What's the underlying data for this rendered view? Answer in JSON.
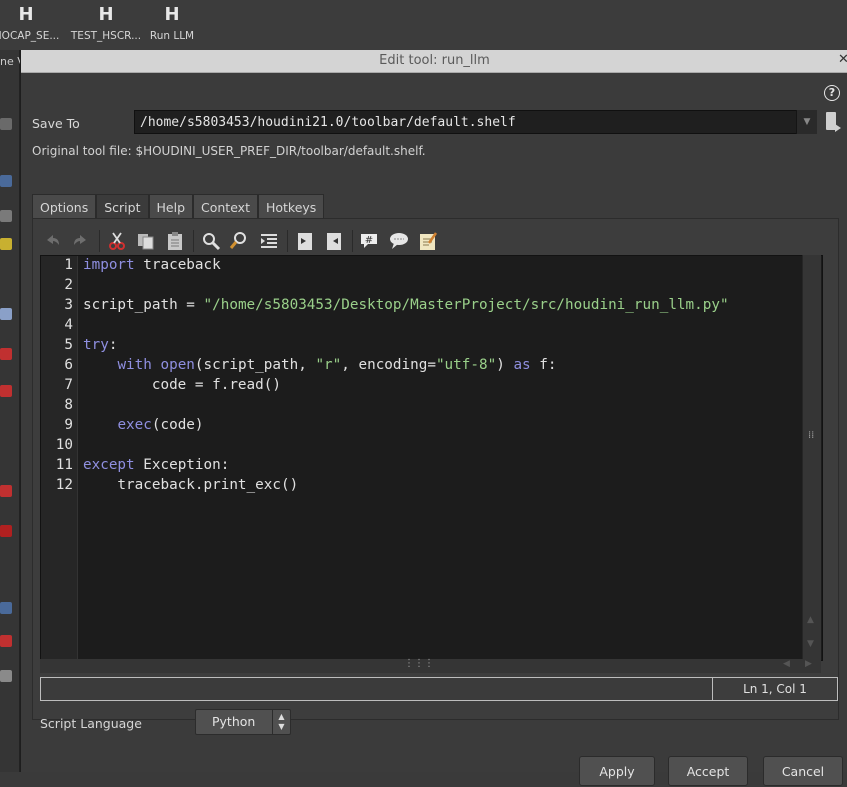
{
  "shelf": {
    "tools": [
      {
        "label": "MOCAP_SE...",
        "icon": "houdini-h-icon"
      },
      {
        "label": "TEST_HSCR...",
        "icon": "houdini-h-icon"
      },
      {
        "label": "Run LLM",
        "icon": "houdini-h-icon"
      }
    ],
    "partial_label": "ne V"
  },
  "dialog": {
    "title": "Edit tool: run_llm",
    "close": "✕",
    "help": "?",
    "save_to_label": "Save To",
    "save_to_value": "/home/s5803453/houdini21.0/toolbar/default.shelf",
    "original_file": "Original tool file: $HOUDINI_USER_PREF_DIR/toolbar/default.shelf.",
    "tabs": [
      "Options",
      "Script",
      "Help",
      "Context",
      "Hotkeys"
    ],
    "active_tab": "Script",
    "toolbar_icons": [
      "undo-icon",
      "redo-icon",
      "cut-icon",
      "copy-icon",
      "paste-icon",
      "find-icon",
      "find-replace-icon",
      "indent-icon",
      "comment-block-icon",
      "uncomment-block-icon",
      "hash-comment-icon",
      "speech-comment-icon",
      "notepad-icon"
    ],
    "code_lines": [
      {
        "n": "1",
        "tokens": [
          [
            "kw",
            "import"
          ],
          [
            "t",
            " traceback"
          ]
        ]
      },
      {
        "n": "2",
        "tokens": []
      },
      {
        "n": "3",
        "tokens": [
          [
            "t",
            "script_path = "
          ],
          [
            "st",
            "\"/home/s5803453/Desktop/MasterProject/src/houdini_run_llm.py\""
          ]
        ]
      },
      {
        "n": "4",
        "tokens": []
      },
      {
        "n": "5",
        "tokens": [
          [
            "kw",
            "try"
          ],
          [
            "t",
            ":"
          ]
        ]
      },
      {
        "n": "6",
        "tokens": [
          [
            "t",
            "    "
          ],
          [
            "kw",
            "with"
          ],
          [
            "t",
            " "
          ],
          [
            "kw",
            "open"
          ],
          [
            "t",
            "(script_path, "
          ],
          [
            "st",
            "\"r\""
          ],
          [
            "t",
            ", encoding="
          ],
          [
            "st",
            "\"utf-8\""
          ],
          [
            "t",
            ") "
          ],
          [
            "kw",
            "as"
          ],
          [
            "t",
            " f:"
          ]
        ]
      },
      {
        "n": "7",
        "tokens": [
          [
            "t",
            "        code = f.read()"
          ]
        ]
      },
      {
        "n": "8",
        "tokens": []
      },
      {
        "n": "9",
        "tokens": [
          [
            "t",
            "    "
          ],
          [
            "kw",
            "exec"
          ],
          [
            "t",
            "(code)"
          ]
        ]
      },
      {
        "n": "10",
        "tokens": []
      },
      {
        "n": "11",
        "tokens": [
          [
            "kw",
            "except"
          ],
          [
            "t",
            " Exception:"
          ]
        ]
      },
      {
        "n": "12",
        "tokens": [
          [
            "t",
            "    traceback.print_exc()"
          ]
        ]
      }
    ],
    "status_position": "Ln 1, Col 1",
    "script_language_label": "Script Language",
    "script_language_value": "Python",
    "buttons": {
      "apply": "Apply",
      "accept": "Accept",
      "cancel": "Cancel"
    },
    "colors": {
      "keyword": "#8f8fe0",
      "string": "#9ad08a",
      "editor_bg": "#1c1c1c"
    }
  }
}
